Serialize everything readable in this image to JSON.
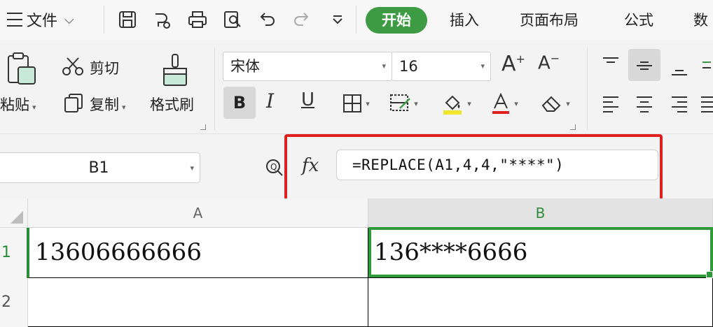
{
  "menubar": {
    "file_label": "文件",
    "tabs": [
      "开始",
      "插入",
      "页面布局",
      "公式",
      "数"
    ],
    "active_tab_color": "#3d9c43"
  },
  "ribbon": {
    "paste_label": "粘贴",
    "cut_label": "剪切",
    "copy_label": "复制",
    "format_painter_label": "格式刷",
    "font_name": "宋体",
    "font_size": "16",
    "bold_label": "B",
    "italic_label": "I",
    "underline_label": "U",
    "grow_font_label": "A",
    "shrink_font_label": "A"
  },
  "formula_bar": {
    "name_box": "B1",
    "fx_label": "fx",
    "formula": "=REPLACE(A1,4,4,\"****\")",
    "highlight_color": "#e0201f"
  },
  "grid": {
    "columns": [
      "A",
      "B"
    ],
    "rows": [
      "1",
      "2"
    ],
    "cells": {
      "A1": "13606666666",
      "B1": "136****6666",
      "A2": "",
      "B2": ""
    },
    "active_cell": "B1",
    "selection_color": "#2e9a3a"
  }
}
